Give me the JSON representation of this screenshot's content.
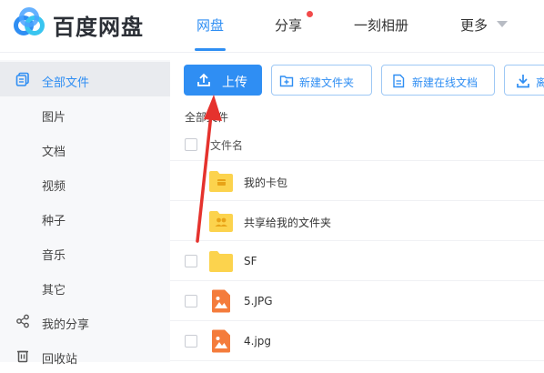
{
  "header": {
    "brand": "百度网盘",
    "nav": [
      {
        "label": "网盘",
        "active": true
      },
      {
        "label": "分享",
        "badge": true
      },
      {
        "label": "一刻相册"
      },
      {
        "label": "更多"
      }
    ]
  },
  "sidebar": {
    "items": [
      {
        "label": "全部文件",
        "icon": "all-files-icon",
        "active": true
      },
      {
        "label": "图片"
      },
      {
        "label": "文档"
      },
      {
        "label": "视频"
      },
      {
        "label": "种子"
      },
      {
        "label": "音乐"
      },
      {
        "label": "其它"
      },
      {
        "label": "我的分享",
        "icon": "share-icon"
      },
      {
        "label": "回收站",
        "icon": "trash-icon"
      }
    ]
  },
  "toolbar": {
    "upload": "上传",
    "new_folder": "新建文件夹",
    "new_online_doc": "新建在线文档",
    "download_partial": "离"
  },
  "breadcrumb": "全部文件",
  "table": {
    "column_name": "文件名",
    "rows": [
      {
        "name": "我的卡包",
        "type": "folder-card"
      },
      {
        "name": "共享给我的文件夹",
        "type": "folder-shared"
      },
      {
        "name": "SF",
        "type": "folder"
      },
      {
        "name": "5.JPG",
        "type": "image"
      },
      {
        "name": "4.jpg",
        "type": "image"
      }
    ]
  },
  "colors": {
    "accent": "#2f8ef3",
    "badge": "#f24a4a",
    "folder": "#fcd34d",
    "image_icon": "#f47c3c",
    "annotation_arrow": "#e5322d"
  }
}
